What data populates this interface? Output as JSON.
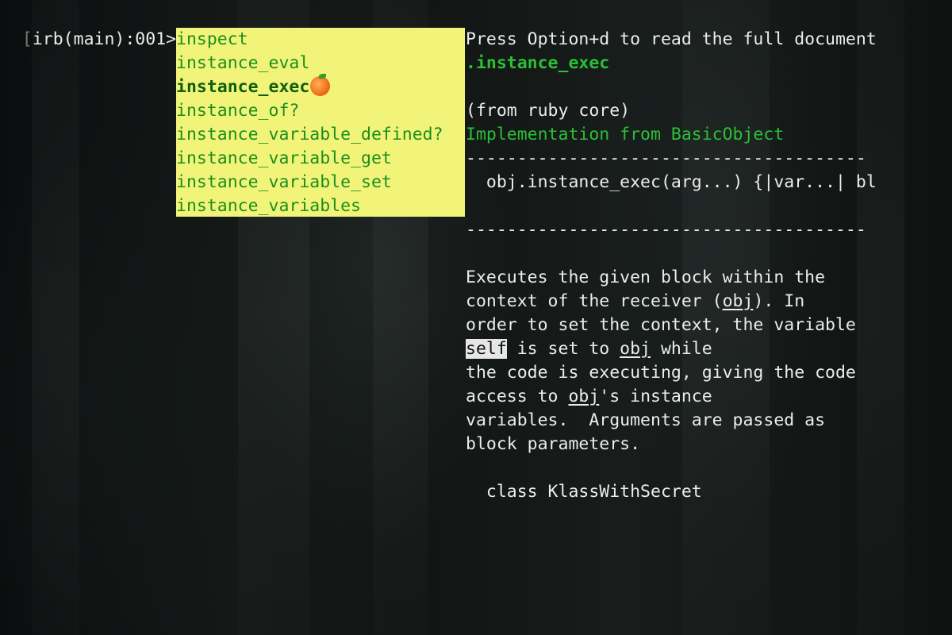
{
  "prompt": {
    "open_bracket": "[",
    "label": "irb(main):001> ",
    "input": "instance_exec"
  },
  "completion": {
    "items": [
      "inspect",
      "instance_eval",
      "instance_exec",
      "instance_of?",
      "instance_variable_defined?",
      "instance_variable_get",
      "instance_variable_set",
      "instance_variables"
    ],
    "selected_index": 2,
    "selected_emoji": "tangerine-icon"
  },
  "doc": {
    "hint": "Press Option+d to read the full document",
    "method_title": ".instance_exec",
    "source": "(from ruby core)",
    "implementation": "Implementation from BasicObject",
    "rule": "---------------------------------------",
    "signature": "  obj.instance_exec(arg...) {|var...| bl",
    "para": {
      "l1": "Executes the given block within the",
      "l2_a": "context of the receiver (",
      "l2_obj": "obj",
      "l2_b": "). In",
      "l3": "order to set the context, the variable",
      "l4_self": "self",
      "l4_a": " is set to ",
      "l4_obj": "obj",
      "l4_b": " while",
      "l5": "the code is executing, giving the code",
      "l6_a": "access to ",
      "l6_obj": "obj",
      "l6_b": "'s instance",
      "l7": "variables.  Arguments are passed as",
      "l8": "block parameters."
    },
    "code_line": "  class KlassWithSecret"
  },
  "colors": {
    "menu_background": "#f2f47a",
    "menu_text": "#1b8f1b",
    "doc_green": "#2bbf36",
    "terminal_text": "#ececec"
  }
}
